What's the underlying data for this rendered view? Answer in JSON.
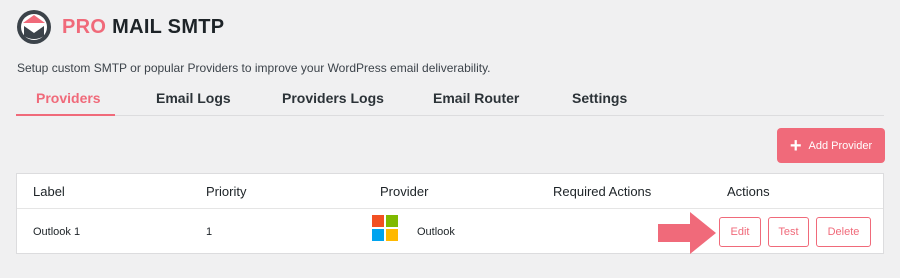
{
  "brand": {
    "accent_word": "PRO",
    "name": "MAIL SMTP",
    "accent_color": "#f06a7a"
  },
  "subtitle": "Setup custom SMTP or popular Providers to improve your WordPress email deliverability.",
  "tabs": [
    {
      "label": "Providers",
      "active": true
    },
    {
      "label": "Email Logs",
      "active": false
    },
    {
      "label": "Providers Logs",
      "active": false
    },
    {
      "label": "Email Router",
      "active": false
    },
    {
      "label": "Settings",
      "active": false
    }
  ],
  "add_provider_label": "Add Provider",
  "table": {
    "headers": [
      "Label",
      "Priority",
      "Provider",
      "Required Actions",
      "Actions"
    ],
    "rows": [
      {
        "label": "Outlook 1",
        "priority": "1",
        "provider": "Outlook",
        "provider_icon": "microsoft-logo-icon",
        "required_actions": "",
        "actions": {
          "edit": "Edit",
          "test": "Test",
          "delete": "Delete"
        }
      }
    ]
  },
  "annotation": {
    "icon": "arrow-right-icon",
    "color": "#f06a7a"
  }
}
